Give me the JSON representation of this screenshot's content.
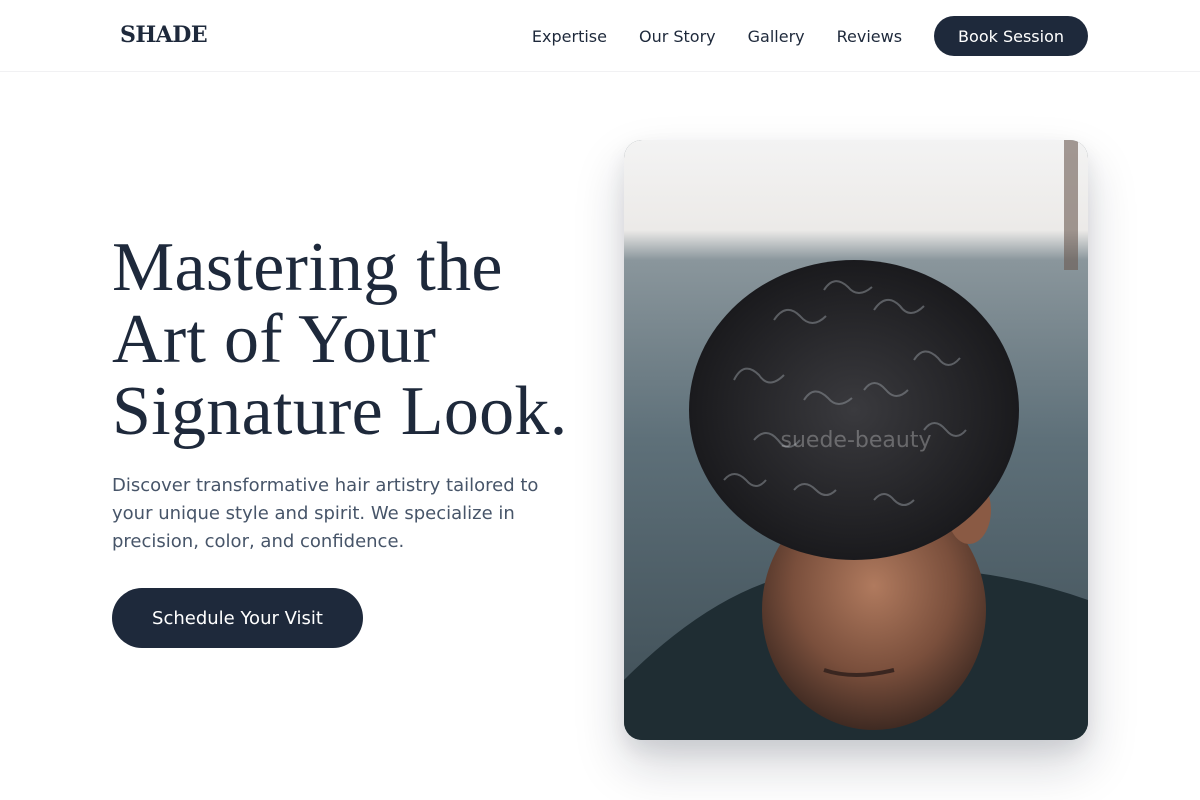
{
  "brand": {
    "name": "SHADE"
  },
  "nav": {
    "links": [
      {
        "label": "Expertise"
      },
      {
        "label": "Our Story"
      },
      {
        "label": "Gallery"
      },
      {
        "label": "Reviews"
      }
    ],
    "cta_label": "Book Session"
  },
  "hero": {
    "title_line1": "Mastering the",
    "title_line2": "Art of Your",
    "title_line3": "Signature Look.",
    "subtitle": "Discover transformative hair artistry tailored to your unique style and spirit. We specialize in precision, color, and confidence.",
    "cta_label": "Schedule Your Visit"
  },
  "image": {
    "watermark": "suede-beauty"
  },
  "colors": {
    "primary": "#1e293b",
    "text_muted": "#475569",
    "background": "#ffffff"
  }
}
